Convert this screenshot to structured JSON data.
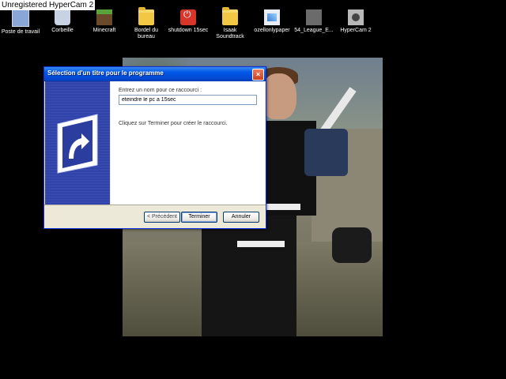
{
  "watermark": "Unregistered HyperCam 2",
  "desktop_icons": [
    {
      "label": "Poste de travail",
      "icon": "computer-icon"
    },
    {
      "label": "Corbeille",
      "icon": "recycle-bin-icon"
    },
    {
      "label": "Minecraft",
      "icon": "minecraft-icon"
    },
    {
      "label_line1": "Bordel du",
      "label_line2": "bureau",
      "icon": "folder-icon"
    },
    {
      "label": "shutdown 15sec",
      "icon": "shutdown-icon"
    },
    {
      "label_line1": "Isaak",
      "label_line2": "Soundtrack",
      "icon": "folder-icon"
    },
    {
      "label": "ozellonlypaper",
      "icon": "paper-icon"
    },
    {
      "label": "54_League_E...",
      "icon": "file-icon"
    },
    {
      "label": "HyperCam 2",
      "icon": "hypercam-icon"
    }
  ],
  "dialog": {
    "title": "Sélection d'un titre pour le programme",
    "close_glyph": "×",
    "prompt": "Entrez un nom pour ce raccourci :",
    "input_value": "eteindre le pc a 15sec",
    "hint": "Cliquez sur Terminer pour créer le raccourci.",
    "buttons": {
      "back": "< Précédent",
      "finish": "Terminer",
      "cancel": "Annuler"
    }
  },
  "colors": {
    "titlebar": "#0058e6",
    "dialog_bg": "#ece9d8",
    "banner": "#2c3da0",
    "desktop_bg": "#000000"
  }
}
